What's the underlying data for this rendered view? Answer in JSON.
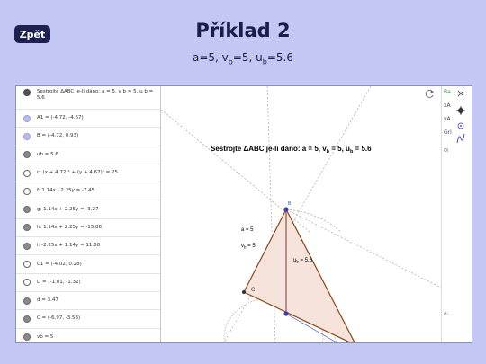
{
  "header": {
    "back_label": "Zpět",
    "title": "Příklad 2",
    "subtitle_parts": [
      "a=5, v",
      "b",
      "=5, u",
      "b",
      "=5.6"
    ]
  },
  "algebra": {
    "items": [
      {
        "text": "Sestrojte ΔABC je-li dáno: a = 5, v b = 5, u b = 5.6",
        "marble": "dark"
      },
      {
        "text": "A1 = (-4.72, -4.67)",
        "marble": "light"
      },
      {
        "text": "B = (-4.72, 0.93)",
        "marble": "light"
      },
      {
        "text": "ub = 5.6",
        "marble": "grey"
      },
      {
        "text": "c: (x + 4.72)² + (y + 4.67)² = 25",
        "marble": "empty"
      },
      {
        "text": "f: 1.14x - 2.25y = -7.45",
        "marble": "empty"
      },
      {
        "text": "g: 1.14x + 2.25y = -3.27",
        "marble": "grey"
      },
      {
        "text": "h: 1.14x + 2.25y = -15.88",
        "marble": "grey"
      },
      {
        "text": "i: -2.25x + 1.14y = 11.68",
        "marble": "grey"
      },
      {
        "text": "C1 = (-4.02, 0.28)",
        "marble": "empty"
      },
      {
        "text": "D = (-1.01, -1.32)",
        "marble": "empty"
      },
      {
        "text": "d = 3.47",
        "marble": "grey"
      },
      {
        "text": "C = (-6.97, -3.53)",
        "marble": "grey"
      },
      {
        "text": "vb = 5",
        "marble": "grey"
      }
    ]
  },
  "canvas": {
    "heading_parts": [
      "Sestrojte ΔABC je-li dáno: a = 5, v",
      "b",
      " = 5, u",
      "b",
      " = 5.6"
    ],
    "label_a": "a = 5",
    "label_vb_main": "v",
    "label_vb_sub": "b",
    "label_vb_val": " = 5",
    "label_ub_main": "u",
    "label_ub_sub": "b",
    "label_ub_val": " = 5.6",
    "point_B": "B",
    "point_C": "C"
  },
  "side": {
    "items": [
      "Ba",
      "xA",
      "yA",
      "Gri",
      "Ol",
      "A:"
    ]
  },
  "colors": {
    "background": "#c2c8f3",
    "back_button": "#1e2050",
    "triangle_stroke": "#8b4513",
    "triangle_fill": "#f5e3dc",
    "point_blue": "#3c3cb4"
  }
}
